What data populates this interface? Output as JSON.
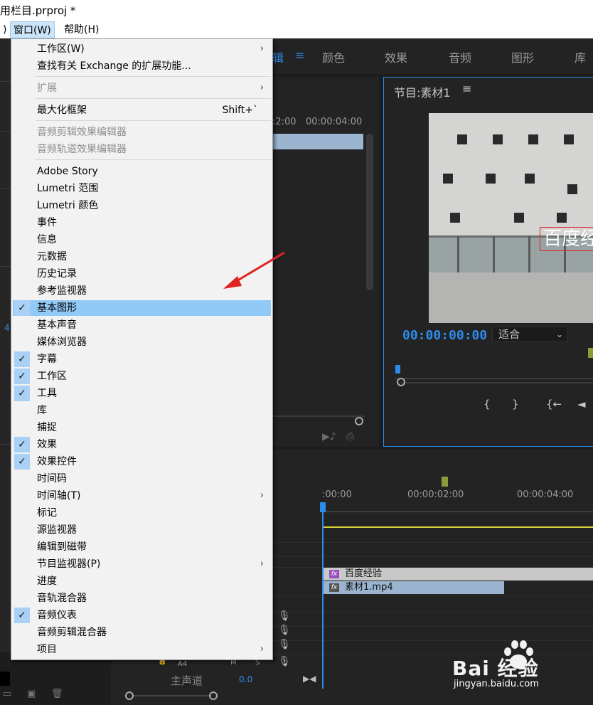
{
  "window": {
    "title_fragment": "用栏目.prproj *"
  },
  "menubar": {
    "cut_item": ")",
    "window_label": "窗口(W)",
    "help_label": "帮助(H)"
  },
  "workspace_tabs": [
    {
      "label": "辑",
      "active": true
    },
    {
      "label": "≡",
      "active": true
    },
    {
      "label": "颜色",
      "active": false
    },
    {
      "label": "效果",
      "active": false
    },
    {
      "label": "音频",
      "active": false
    },
    {
      "label": "图形",
      "active": false
    },
    {
      "label": "库",
      "active": false
    }
  ],
  "window_menu": [
    {
      "label": "工作区(W)",
      "submenu": true
    },
    {
      "label": "查找有关 Exchange 的扩展功能..."
    },
    {
      "separator": true
    },
    {
      "label": "扩展",
      "disabled": true,
      "submenu": true
    },
    {
      "separator": true
    },
    {
      "label": "最大化框架",
      "shortcut": "Shift+`"
    },
    {
      "separator": true
    },
    {
      "label": "音频剪辑效果编辑器",
      "disabled": true
    },
    {
      "label": "音频轨道效果编辑器",
      "disabled": true
    },
    {
      "separator": true
    },
    {
      "label": "Adobe Story"
    },
    {
      "label": "Lumetri 范围"
    },
    {
      "label": "Lumetri 颜色"
    },
    {
      "label": "事件"
    },
    {
      "label": "信息"
    },
    {
      "label": "元数据"
    },
    {
      "label": "历史记录"
    },
    {
      "label": "参考监视器"
    },
    {
      "label": "基本图形",
      "checked": true,
      "highlighted": true
    },
    {
      "label": "基本声音"
    },
    {
      "label": "媒体浏览器"
    },
    {
      "label": "字幕",
      "checked": true
    },
    {
      "label": "工作区",
      "checked": true
    },
    {
      "label": "工具",
      "checked": true
    },
    {
      "label": "库"
    },
    {
      "label": "捕捉"
    },
    {
      "label": "效果",
      "checked": true
    },
    {
      "label": "效果控件",
      "checked": true
    },
    {
      "label": "时间码"
    },
    {
      "label": "时间轴(T)",
      "submenu": true
    },
    {
      "label": "标记"
    },
    {
      "label": "源监视器"
    },
    {
      "label": "编辑到磁带"
    },
    {
      "label": "节目监视器(P)",
      "submenu": true
    },
    {
      "label": "进度"
    },
    {
      "label": "音轨混合器"
    },
    {
      "label": "音频仪表",
      "checked": true
    },
    {
      "label": "音频剪辑混合器"
    },
    {
      "label": "项目",
      "submenu": true
    }
  ],
  "source_panel": {
    "tc_a": ":2:00",
    "tc_b": "00:00:04:00"
  },
  "program_monitor": {
    "title": "节目:素材1",
    "menu_icon": "≡",
    "overlay_text": "百度经",
    "timecode": "00:00:00:00",
    "fit_value": "适合",
    "buttons": [
      "{",
      "}",
      "{←",
      "◄"
    ]
  },
  "timeline": {
    "ruler": [
      ":00:00",
      "00:00:02:00",
      "00:00:04:00"
    ],
    "title_clip": "百度经验",
    "video_clip": "素材1.mp4",
    "fx": "fx",
    "track_a4": "A4",
    "track_m": "M",
    "track_s": "S",
    "master_label": "主声道",
    "master_value": "0.0"
  },
  "left_fragment": {
    "digit": "4"
  },
  "watermark": {
    "brand": "Bai 经验",
    "url": "jingyan.baidu.com"
  },
  "colors": {
    "accent": "#2d8ceb",
    "highlight": "#91c9f7",
    "check_bg": "#a9d1f5",
    "arrow": "#e02222"
  }
}
